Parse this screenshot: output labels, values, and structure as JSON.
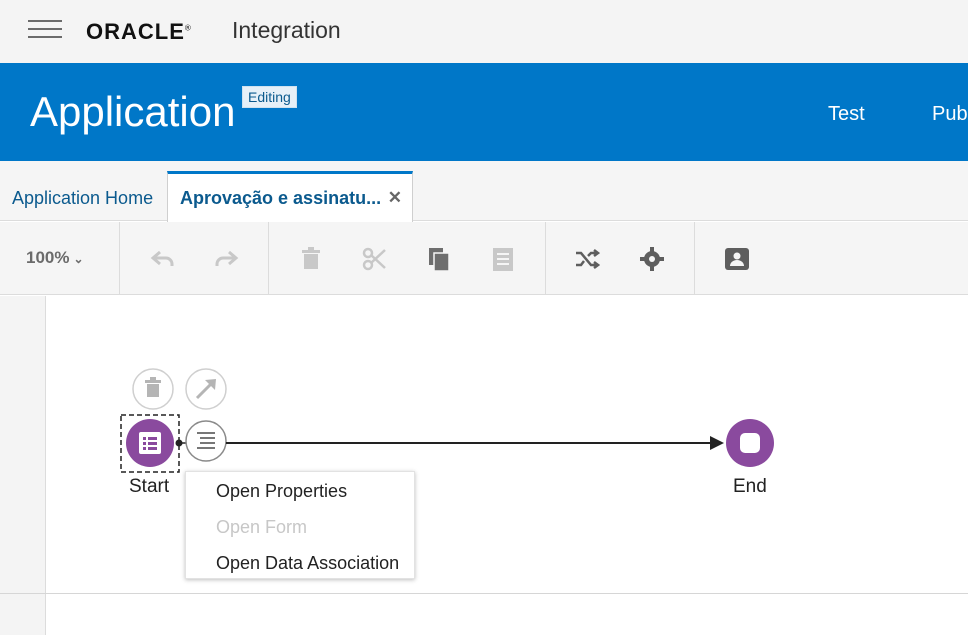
{
  "header": {
    "brand": "ORACLE",
    "product": "Integration"
  },
  "banner": {
    "title": "Application",
    "badge": "Editing",
    "actions": [
      "Test",
      "Pub"
    ]
  },
  "tabs": [
    {
      "label": "Application Home",
      "active": false
    },
    {
      "label": "Aprovação e assinatu...",
      "active": true,
      "closable": true
    }
  ],
  "tab_close_glyph": "✕",
  "toolbar": {
    "zoom": "100%",
    "icons": [
      "undo-icon",
      "redo-icon",
      "delete-icon",
      "cut-icon",
      "copy-icon",
      "paste-icon",
      "shuffle-icon",
      "settings-icon",
      "contact-card-icon"
    ]
  },
  "flow": {
    "nodes": [
      {
        "id": "start",
        "label": "Start",
        "icon": "form-icon",
        "color": "#8a4a9e"
      },
      {
        "id": "end",
        "label": "End",
        "icon": "stop-icon",
        "color": "#8a4a9e"
      }
    ],
    "node_actions": [
      "trash-icon",
      "arrow-icon",
      "menu-icon"
    ]
  },
  "context_menu": {
    "items": [
      {
        "label": "Open Properties",
        "enabled": true
      },
      {
        "label": "Open Form",
        "enabled": false
      },
      {
        "label": "Open Data Association",
        "enabled": true
      }
    ]
  },
  "colors": {
    "banner": "#0077c8",
    "node": "#8a4a9e"
  }
}
